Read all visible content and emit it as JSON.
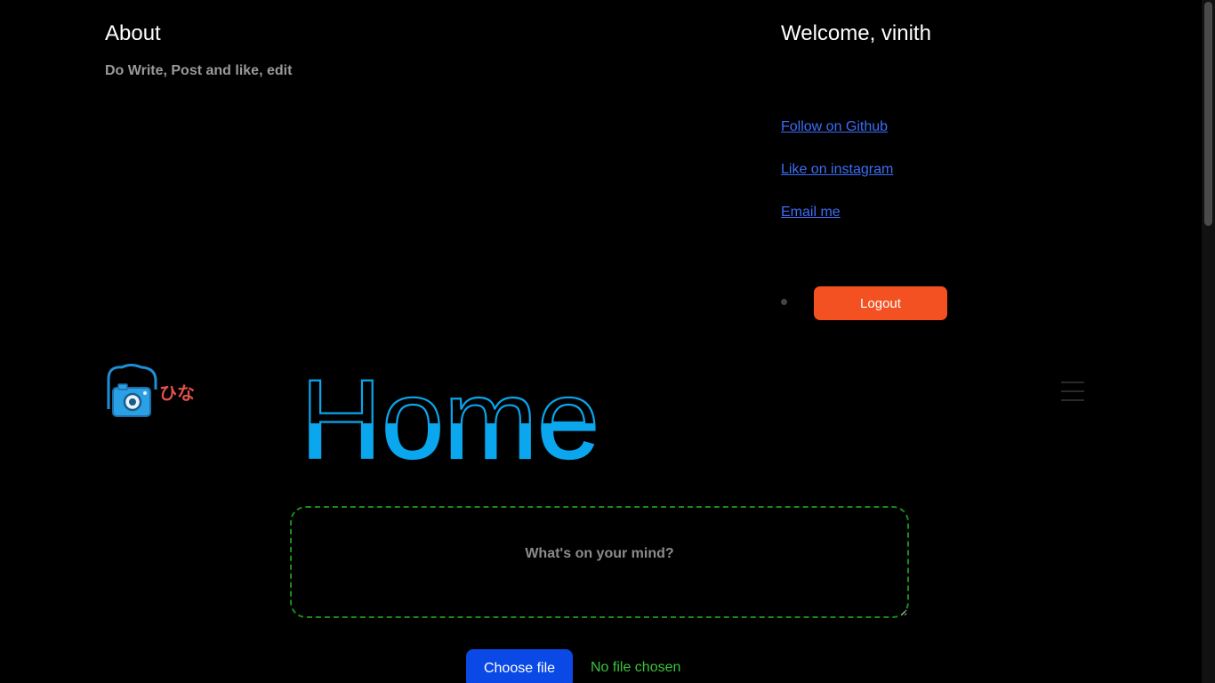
{
  "about": {
    "title": "About",
    "text": "Do Write, Post and like, edit"
  },
  "welcome": {
    "title": "Welcome, vinith",
    "links": [
      {
        "label": "Follow on Github"
      },
      {
        "label": "Like on instagram"
      },
      {
        "label": "Email me"
      }
    ],
    "logout_label": "Logout"
  },
  "brand": {
    "logo_icon": "camera-icon",
    "logo_text": "ひな"
  },
  "home": {
    "title": "Home"
  },
  "post": {
    "placeholder": "What's on your mind?",
    "choose_file_label": "Choose file",
    "file_status": "No file chosen"
  },
  "colors": {
    "background": "#000000",
    "link": "#3d6df5",
    "logout": "#f45122",
    "home_title": "#0aa6ee",
    "post_border": "#1d8a1d",
    "choose_file": "#0a49e6",
    "file_status": "#3ac33a",
    "logo_text": "#e0524a"
  }
}
